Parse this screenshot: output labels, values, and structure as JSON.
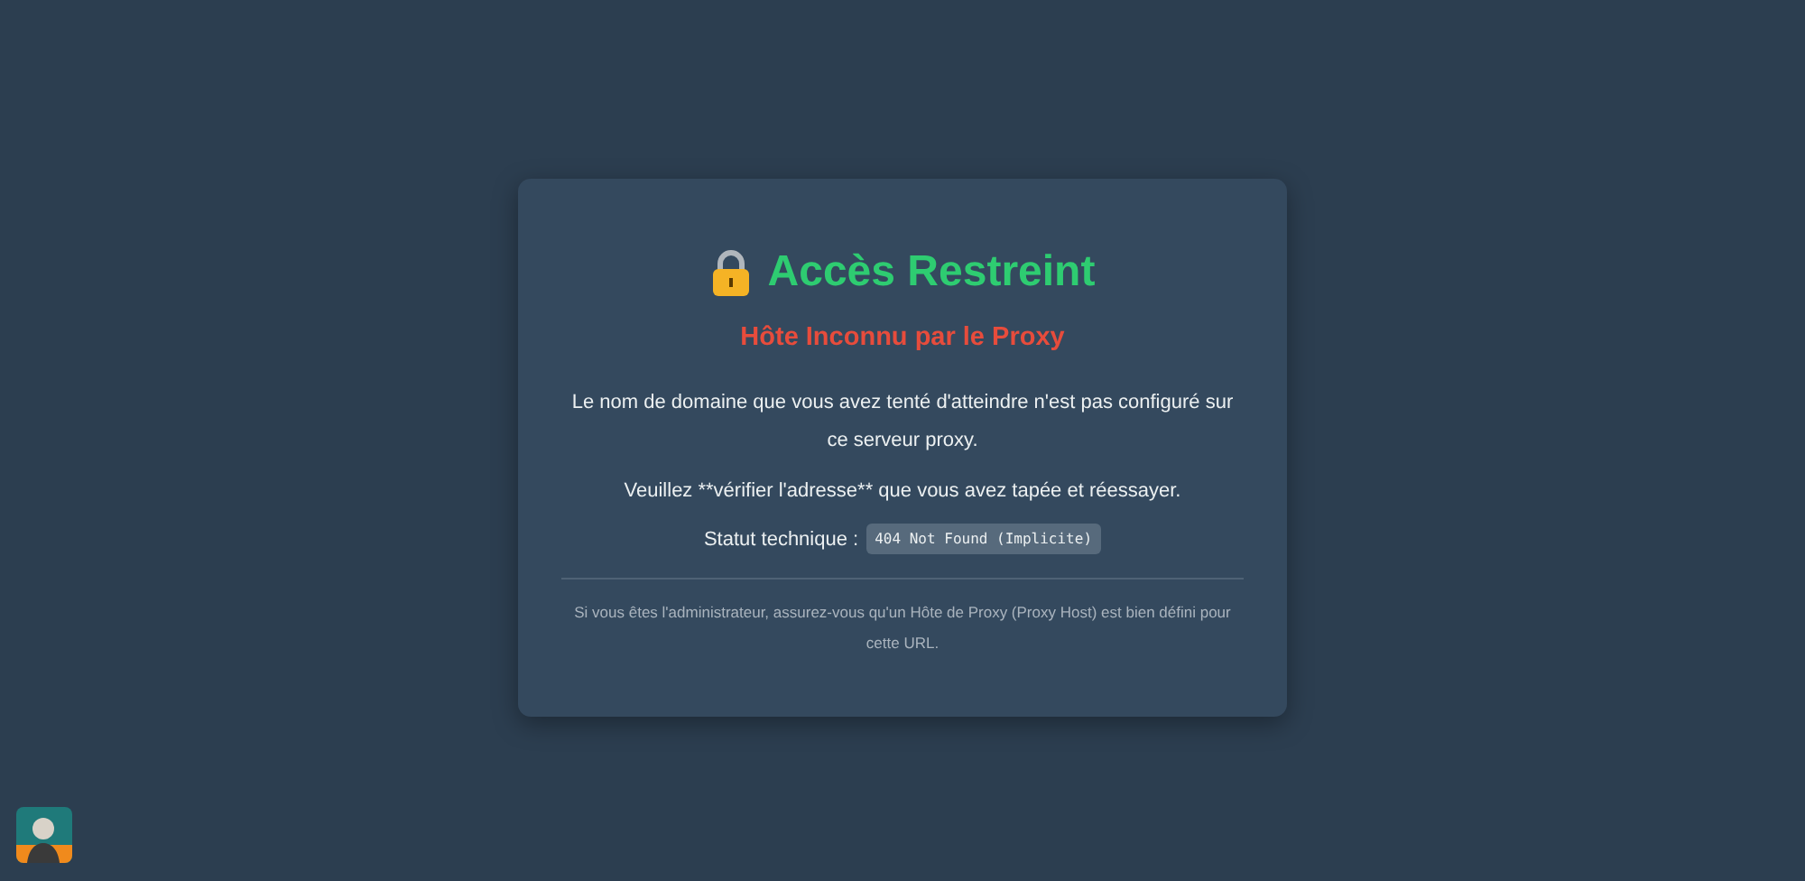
{
  "card": {
    "title": "Accès Restreint",
    "subtitle": "Hôte Inconnu par le Proxy",
    "paragraphs": [
      "Le nom de domaine que vous avez tenté d'atteindre n'est pas configuré sur ce serveur proxy.",
      "Veuillez **vérifier l'adresse** que vous avez tapée et réessayer."
    ],
    "status_label": "Statut technique :",
    "status_code": "404 Not Found (Implicite)",
    "footer": "Si vous êtes l'administrateur, assurez-vous qu'un Hôte de Proxy (Proxy Host) est bien défini pour cette URL."
  }
}
